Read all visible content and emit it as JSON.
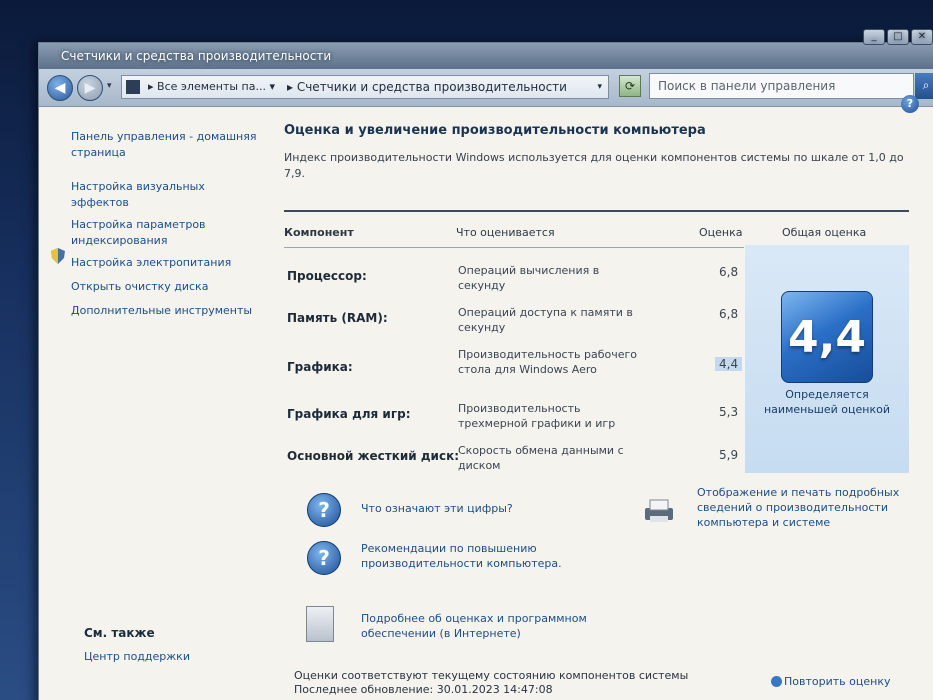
{
  "window": {
    "title": "Счетчики и средства производительности",
    "controls": [
      "_",
      "□",
      "✕"
    ]
  },
  "address": {
    "back_icon": "back-arrow-icon",
    "forward_icon": "forward-arrow-icon",
    "crumb_parent": "▸ Все элементы па... ▾",
    "crumb_current": "▸ Счетчики и средства производительности",
    "dropdown": "▾",
    "refresh": "⟳",
    "search_placeholder": "Поиск в панели управления",
    "search_icon": "⌕"
  },
  "help": "?",
  "sidebar": {
    "items": [
      {
        "label": "Панель управления - домашняя страница"
      },
      {
        "label": "Настройка визуальных эффектов"
      },
      {
        "label": "Настройка параметров индексирования"
      },
      {
        "label": "Настройка электропитания"
      },
      {
        "label": "Открыть очистку диска"
      },
      {
        "label": "Дополнительные инструменты"
      }
    ],
    "see_also": "См. также",
    "support": "Центр поддержки"
  },
  "main": {
    "title": "Оценка и увеличение производительности компьютера",
    "description": "Индекс производительности Windows используется для оценки компонентов системы по шкале от 1,0 до 7,9.",
    "headers": {
      "component": "Компонент",
      "what": "Что оценивается",
      "score": "Оценка",
      "total": "Общая оценка"
    },
    "rows": [
      {
        "name": "Процессор:",
        "desc": "Операций вычисления в секунду",
        "score": "6,8"
      },
      {
        "name": "Память (RAM):",
        "desc": "Операций доступа к памяти в секунду",
        "score": "6,8"
      },
      {
        "name": "Графика:",
        "desc": "Производительность рабочего стола для Windows Aero",
        "score": "4,4"
      },
      {
        "name": "Графика для игр:",
        "desc": "Производительность трехмерной графики и игр",
        "score": "5,3"
      },
      {
        "name": "Основной жесткий диск:",
        "desc": "Скорость обмена данными с диском",
        "score": "5,9"
      }
    ],
    "total_score": "4,4",
    "total_caption": "Определяется наименьшей оценкой",
    "links": {
      "numbers": "Что означают эти цифры?",
      "recommendations": "Рекомендации по повышению производительности компьютера.",
      "print": "Отображение и печать подробных сведений о производительности компьютера и системе",
      "online": "Подробнее об оценках и программном обеспечении (в Интернете)"
    },
    "status_line1": "Оценки соответствуют текущему состоянию компонентов системы",
    "status_line2": "Последнее обновление: 30.01.2023 14:47:08",
    "repeat": "Повторить оценку"
  },
  "colors": {
    "link": "#1d4e86",
    "score_tile": "#2a6fc7",
    "total_panel": "#c6dcf1"
  }
}
